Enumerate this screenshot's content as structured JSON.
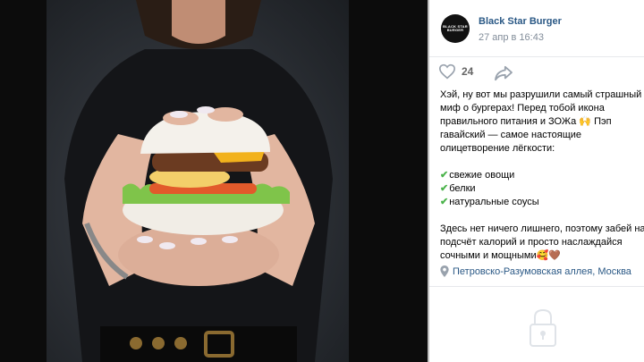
{
  "post": {
    "author": "Black Star Burger",
    "date": "27 апр в 16:43",
    "avatar_text": [
      "BLACK STAR",
      "BURGER"
    ],
    "likes": "24",
    "text_lines": [
      "Хэй, ну вот мы разрушили самый страшный",
      "миф о бургерах! Перед тобой икона",
      "правильного питания и ЗОЖа 🙌 Пэп",
      "гавайский — самое настоящие",
      "олицетворение лёгкости:"
    ],
    "list": [
      "свежие овощи",
      "белки",
      "натуральные соусы"
    ],
    "outro_lines": [
      "Здесь нет ничего лишнего, поэтому забей на",
      "подсчёт калорий и просто наслаждайся",
      "сочными и мощными🥰🤎"
    ],
    "location": "Петровско-Разумовская аллея, Москва"
  },
  "icons": {
    "like": "heart-outline-icon",
    "share": "share-arrow-icon",
    "location": "map-pin-icon",
    "lock": "lock-icon",
    "check": "check-mark-icon"
  },
  "colors": {
    "link": "#2a5885",
    "secondary": "#818c99",
    "check": "#4bb34b"
  }
}
